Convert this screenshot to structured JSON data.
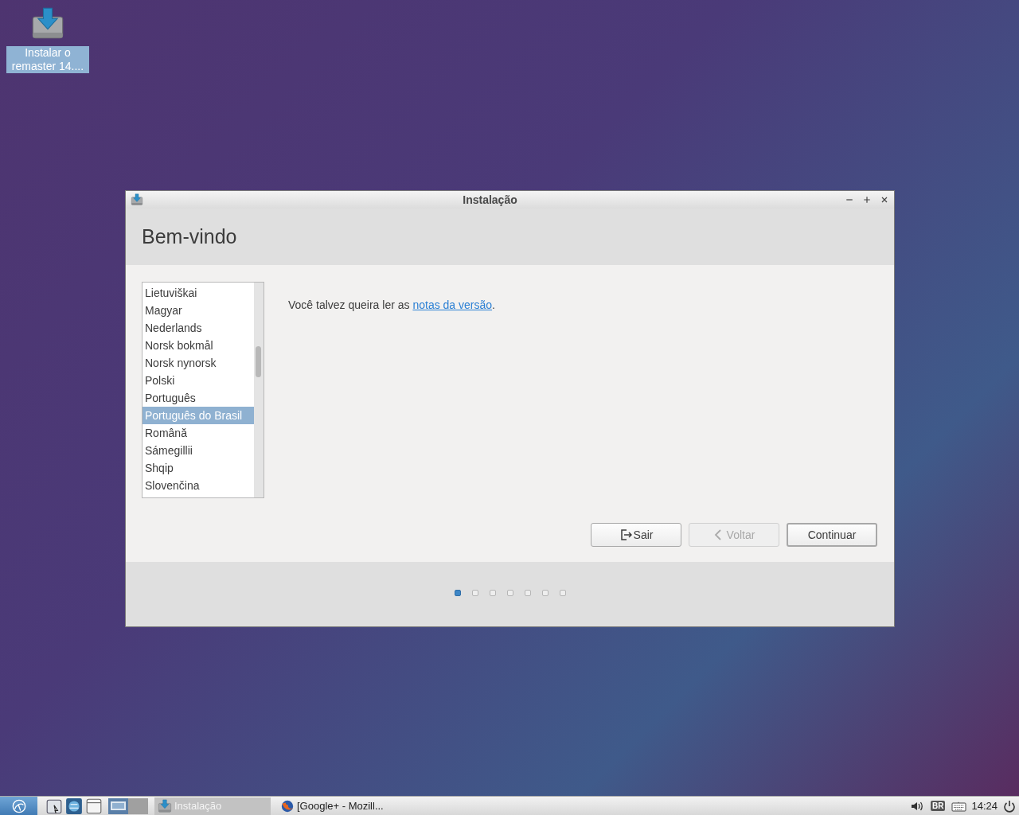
{
  "desktop_icons": [
    {
      "label": "Instalar o remaster 14...."
    }
  ],
  "window": {
    "title": "Instalação",
    "heading": "Bem-vindo",
    "languages": [
      {
        "label": "Lietuviškai",
        "selected": false
      },
      {
        "label": "Magyar",
        "selected": false
      },
      {
        "label": "Nederlands",
        "selected": false
      },
      {
        "label": "Norsk bokmål",
        "selected": false
      },
      {
        "label": "Norsk nynorsk",
        "selected": false
      },
      {
        "label": "Polski",
        "selected": false
      },
      {
        "label": "Português",
        "selected": false
      },
      {
        "label": "Português do Brasil",
        "selected": true
      },
      {
        "label": "Română",
        "selected": false
      },
      {
        "label": "Sámegillii",
        "selected": false
      },
      {
        "label": "Shqip",
        "selected": false
      },
      {
        "label": "Slovenčina",
        "selected": false
      }
    ],
    "message": "Você talvez queira ler as ",
    "link": "notas da versão",
    "message_end": ".",
    "buttons": [
      {
        "label": "Sair",
        "kind": "quit",
        "disabled": false
      },
      {
        "label": "Voltar",
        "kind": "back",
        "disabled": true
      },
      {
        "label": "Continuar",
        "kind": "default",
        "disabled": false
      }
    ],
    "steps": [
      {
        "selected": true
      },
      {
        "selected": false
      },
      {
        "selected": false
      },
      {
        "selected": false
      },
      {
        "selected": false
      },
      {
        "selected": false
      },
      {
        "selected": false
      }
    ]
  },
  "taskbar": {
    "workspaces": [
      {
        "selected": true
      },
      {
        "selected": false
      }
    ],
    "tasks": [
      {
        "label": "Instalação",
        "kind": "installer",
        "selected": true
      },
      {
        "label": "[Google+ - Mozill...",
        "kind": "browser",
        "selected": false
      }
    ],
    "keyboard_layout": "BR",
    "clock": "14:24"
  }
}
